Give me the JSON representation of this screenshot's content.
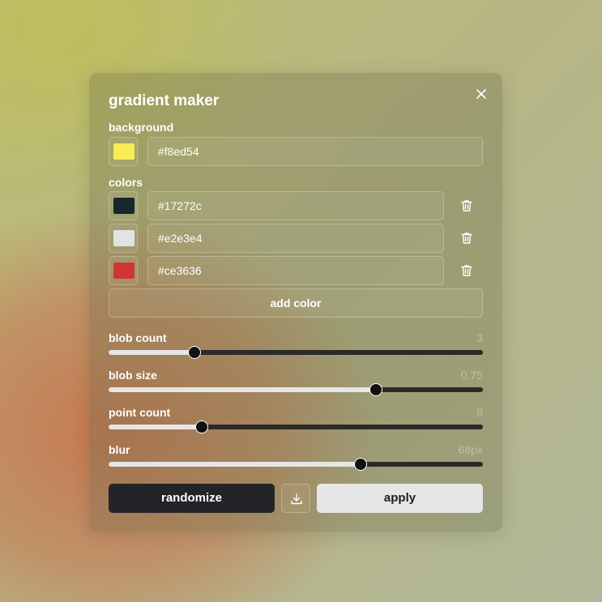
{
  "panel": {
    "title": "gradient maker"
  },
  "background": {
    "label": "background",
    "color": "#f8ed54",
    "value": "#f8ed54"
  },
  "colors": {
    "label": "colors",
    "items": [
      {
        "color": "#17272c",
        "value": "#17272c"
      },
      {
        "color": "#e2e3e4",
        "value": "#e2e3e4"
      },
      {
        "color": "#ce3636",
        "value": "#ce3636"
      }
    ],
    "add_label": "add color"
  },
  "sliders": [
    {
      "label": "blob count",
      "value_text": "3",
      "fraction": 0.23
    },
    {
      "label": "blob size",
      "value_text": "0.75",
      "fraction": 0.714
    },
    {
      "label": "point count",
      "value_text": "8",
      "fraction": 0.248
    },
    {
      "label": "blur",
      "value_text": "68px",
      "fraction": 0.674
    }
  ],
  "actions": {
    "randomize_label": "randomize",
    "apply_label": "apply"
  },
  "icons": {
    "close": "close-icon",
    "trash": "trash-icon",
    "download": "download-icon"
  }
}
